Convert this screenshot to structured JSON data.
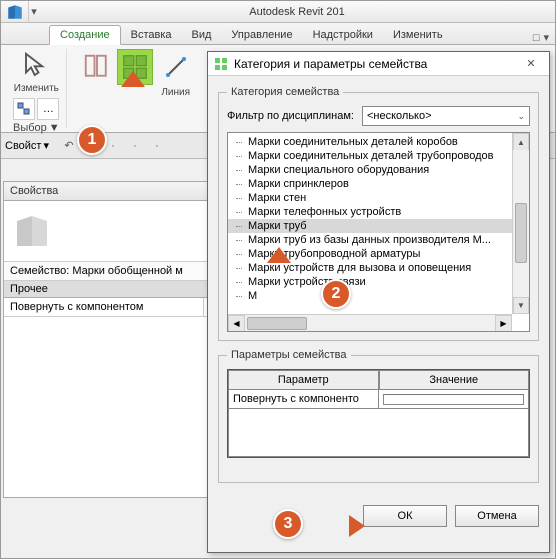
{
  "title_bar": {
    "app_title": "Autodesk Revit 201"
  },
  "tabs": {
    "items": [
      "Создание",
      "Вставка",
      "Вид",
      "Управление",
      "Надстройки",
      "Изменить"
    ],
    "box_glyph": "□",
    "chevron": "▾",
    "active_index": 0
  },
  "ribbon": {
    "modify_label": "Изменить",
    "select_label": "Выбор",
    "select_dd": "▼",
    "line_label": "Линия",
    "ellipsis": "…"
  },
  "qat": {
    "section_label": "Свойст",
    "dd": "▾",
    "icons": [
      "↶",
      "↪",
      "·",
      "·",
      "·"
    ]
  },
  "properties": {
    "title": "Свойства",
    "family_row": "Семейство: Марки обобщенной м",
    "group_label": "Прочее",
    "rotate_label": "Повернуть с компонентом"
  },
  "dialog": {
    "title": "Категория и параметры семейства",
    "category_legend": "Категория семейства",
    "filter_label": "Фильтр по дисциплинам:",
    "filter_value": "<несколько>",
    "filter_dd": "⌄",
    "tree": [
      "Марки соединительных деталей коробов",
      "Марки соединительных деталей трубопроводов",
      "Марки специального оборудования",
      "Марки спринклеров",
      "Марки стен",
      "Марки телефонных устройств",
      "Марки труб",
      "Марки труб из базы данных производителя M...",
      "Марки трубопроводной арматуры",
      "Марки устройств для вызова и оповещения",
      "Марки устройств связи",
      "М"
    ],
    "tree_selected": 6,
    "params_legend": "Параметры семейства",
    "param_header": "Параметр",
    "value_header": "Значение",
    "param_row_label": "Повернуть с компоненто",
    "ok": "ОК",
    "cancel": "Отмена",
    "close_glyph": "✕",
    "scroll_up": "▲",
    "scroll_down": "▼",
    "scroll_left": "◀",
    "scroll_right": "▶"
  },
  "annotations": {
    "b1": "1",
    "b2": "2",
    "b3": "3"
  }
}
